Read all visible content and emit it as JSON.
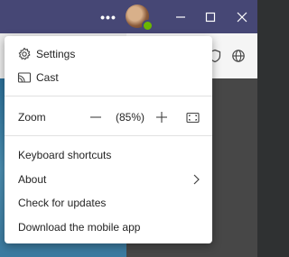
{
  "menu": {
    "items": [
      {
        "label": "Settings",
        "icon": "gear-icon"
      },
      {
        "label": "Cast",
        "icon": "cast-icon"
      }
    ],
    "zoom": {
      "label": "Zoom",
      "value": "(85%)"
    },
    "lower_items": [
      {
        "label": "Keyboard shortcuts"
      },
      {
        "label": "About"
      },
      {
        "label": "Check for updates"
      },
      {
        "label": "Download the mobile app"
      }
    ]
  }
}
